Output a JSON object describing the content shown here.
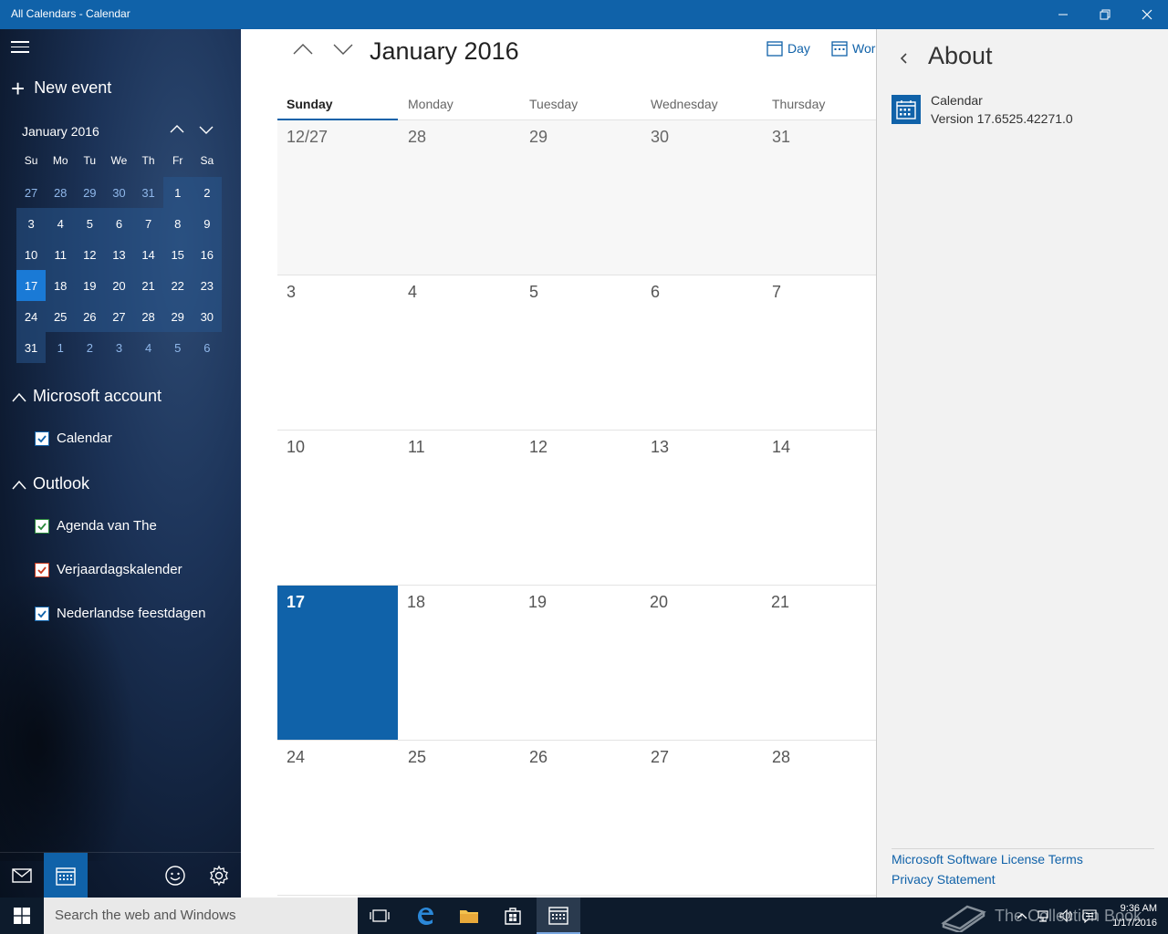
{
  "window": {
    "title": "All Calendars - Calendar"
  },
  "sidebar": {
    "new_event_label": "New event",
    "mini_calendar": {
      "month_label": "January 2016",
      "dow": [
        "Su",
        "Mo",
        "Tu",
        "We",
        "Th",
        "Fr",
        "Sa"
      ],
      "weeks": [
        [
          {
            "d": "27",
            "t": "other"
          },
          {
            "d": "28",
            "t": "other"
          },
          {
            "d": "29",
            "t": "other"
          },
          {
            "d": "30",
            "t": "other"
          },
          {
            "d": "31",
            "t": "other"
          },
          {
            "d": "1",
            "t": "cur"
          },
          {
            "d": "2",
            "t": "cur"
          }
        ],
        [
          {
            "d": "3",
            "t": "cur"
          },
          {
            "d": "4",
            "t": "cur"
          },
          {
            "d": "5",
            "t": "cur"
          },
          {
            "d": "6",
            "t": "cur"
          },
          {
            "d": "7",
            "t": "cur"
          },
          {
            "d": "8",
            "t": "cur"
          },
          {
            "d": "9",
            "t": "cur"
          }
        ],
        [
          {
            "d": "10",
            "t": "cur"
          },
          {
            "d": "11",
            "t": "cur"
          },
          {
            "d": "12",
            "t": "cur"
          },
          {
            "d": "13",
            "t": "cur"
          },
          {
            "d": "14",
            "t": "cur"
          },
          {
            "d": "15",
            "t": "cur"
          },
          {
            "d": "16",
            "t": "cur"
          }
        ],
        [
          {
            "d": "17",
            "t": "sel"
          },
          {
            "d": "18",
            "t": "cur"
          },
          {
            "d": "19",
            "t": "cur"
          },
          {
            "d": "20",
            "t": "cur"
          },
          {
            "d": "21",
            "t": "cur"
          },
          {
            "d": "22",
            "t": "cur"
          },
          {
            "d": "23",
            "t": "cur"
          }
        ],
        [
          {
            "d": "24",
            "t": "cur"
          },
          {
            "d": "25",
            "t": "cur"
          },
          {
            "d": "26",
            "t": "cur"
          },
          {
            "d": "27",
            "t": "cur"
          },
          {
            "d": "28",
            "t": "cur"
          },
          {
            "d": "29",
            "t": "cur"
          },
          {
            "d": "30",
            "t": "cur"
          }
        ],
        [
          {
            "d": "31",
            "t": "cur"
          },
          {
            "d": "1",
            "t": "other"
          },
          {
            "d": "2",
            "t": "other"
          },
          {
            "d": "3",
            "t": "other"
          },
          {
            "d": "4",
            "t": "other"
          },
          {
            "d": "5",
            "t": "other"
          },
          {
            "d": "6",
            "t": "other"
          }
        ]
      ]
    },
    "groups": {
      "microsoft": "Microsoft account",
      "outlook": "Outlook"
    },
    "calendars": {
      "calendar": {
        "label": "Calendar",
        "color": "#1062a9"
      },
      "agenda": {
        "label": "Agenda van The",
        "color": "#2a8a3a"
      },
      "verjaardag": {
        "label": "Verjaardagskalender",
        "color": "#c8391e"
      },
      "feestdagen": {
        "label": "Nederlandse feestdagen",
        "color": "#1062a9"
      }
    }
  },
  "main": {
    "month_title": "January 2016",
    "views": {
      "day": "Day",
      "work_week": "Wor"
    },
    "dow": [
      "Sunday",
      "Monday",
      "Tuesday",
      "Wednesday",
      "Thursday"
    ],
    "weeks": [
      [
        {
          "d": "12/27",
          "t": "prev"
        },
        {
          "d": "28",
          "t": "prev"
        },
        {
          "d": "29",
          "t": "prev"
        },
        {
          "d": "30",
          "t": "prev"
        },
        {
          "d": "31",
          "t": "prev"
        }
      ],
      [
        {
          "d": "3"
        },
        {
          "d": "4"
        },
        {
          "d": "5"
        },
        {
          "d": "6"
        },
        {
          "d": "7"
        }
      ],
      [
        {
          "d": "10"
        },
        {
          "d": "11"
        },
        {
          "d": "12"
        },
        {
          "d": "13"
        },
        {
          "d": "14"
        }
      ],
      [
        {
          "d": "17",
          "t": "today"
        },
        {
          "d": "18"
        },
        {
          "d": "19"
        },
        {
          "d": "20"
        },
        {
          "d": "21"
        }
      ],
      [
        {
          "d": "24"
        },
        {
          "d": "25"
        },
        {
          "d": "26"
        },
        {
          "d": "27"
        },
        {
          "d": "28"
        }
      ]
    ]
  },
  "about": {
    "title": "About",
    "app_name": "Calendar",
    "version": "Version 17.6525.42271.0",
    "license_link": "Microsoft Software License Terms",
    "privacy_link": "Privacy Statement"
  },
  "taskbar": {
    "search_placeholder": "Search the web and Windows",
    "watermark": "The Collection Book",
    "time": "9:36 AM",
    "date": "1/17/2016"
  },
  "colors": {
    "accent": "#1062a9",
    "today": "#1a7ad6",
    "taskbar": "#0d1b2c"
  }
}
